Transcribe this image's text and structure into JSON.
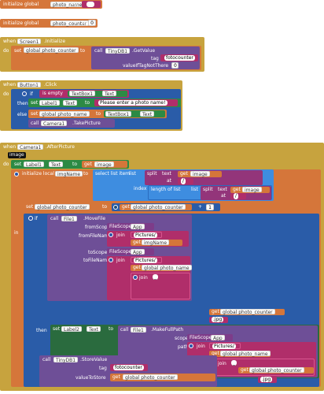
{
  "blocks": {
    "init1": {
      "label": "initialize global",
      "name": "photo_name",
      "to": "to",
      "value": ""
    },
    "init2": {
      "label": "initialize global",
      "name": "photo_counter",
      "to": "to",
      "value": "0"
    },
    "screen_init": {
      "when": "when",
      "component": "Screen1",
      "event": ".Initialize",
      "do": "do",
      "set": "set",
      "var": "global photo_counter",
      "to": "to",
      "call": "call",
      "db": "TinyDB1",
      "method": ".GetValue",
      "tag_label": "tag",
      "tag_value": "fotocounter",
      "ifnot_label": "valueIfTagNotThere",
      "ifnot_value": "0"
    },
    "button_click": {
      "when": "when",
      "component": "Button1",
      "event": ".Click",
      "do": "do",
      "if": "if",
      "is_empty": "is empty",
      "textbox": "TextBox1",
      "prop_text": "Text",
      "then": "then",
      "set": "set",
      "label1": "Label1",
      "to": "to",
      "message": "Please enter a photo name!",
      "else": "else",
      "var": "global photo_name",
      "call": "call",
      "camera": "Camera1",
      "method": ".TakePicture"
    },
    "after_picture": {
      "when": "when",
      "component": "Camera1",
      "event": ".AfterPicture",
      "param": "image",
      "do": "do",
      "set": "set",
      "label1": "Label1",
      "prop_text": "Text",
      "to": "to",
      "get": "get",
      "image": "image",
      "init_local": "initialize local",
      "local_name": "imgName",
      "to2": "to",
      "select": "select list item",
      "list": "list",
      "split": "split",
      "text": "text",
      "at": "at",
      "slash": "/",
      "index": "index",
      "length": "length of list",
      "one": "1",
      "in": "in",
      "counter_var": "global photo_counter",
      "plus": "+",
      "if": "if",
      "call": "call",
      "file": "File1",
      "move": ".MoveFile",
      "from_scope": "fromScope",
      "scope_label": "FileScope",
      "scope_value": "App",
      "from_file": "fromFileName",
      "join": "join",
      "pictures": "Pictures/",
      "img_name": "imgName",
      "to_scope": "toScope",
      "to_file": "toFileName",
      "photo_name_var": "global photo_name",
      "underscore": "_",
      "jpg": ".jpg",
      "then": "then",
      "label2": "Label2",
      "make_full": ".MakeFullPath",
      "scope": "scope",
      "path": "path",
      "db": "TinyDB1",
      "store": ".StoreValue",
      "tag": "tag",
      "tag_value": "fotocounter",
      "value_to_store": "valueToStore"
    }
  }
}
